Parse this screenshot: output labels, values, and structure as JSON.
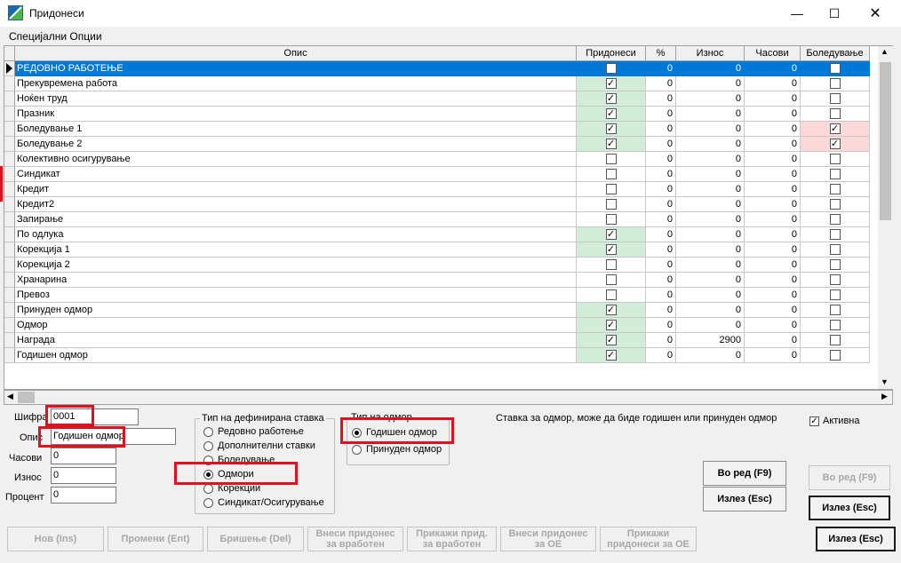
{
  "window": {
    "title": "Придонеси"
  },
  "menu": {
    "special_options": "Специјални Опции"
  },
  "grid": {
    "columns": [
      "Опис",
      "Придонеси",
      "%",
      "Износ",
      "Часови",
      "Боледување"
    ],
    "rows": [
      {
        "desc": "РЕДОВНО РАБОТЕЊЕ",
        "contrib": true,
        "pct": "0",
        "amount": "0",
        "hours": "0",
        "sick": false,
        "selected": true,
        "green": false,
        "pink": false
      },
      {
        "desc": "Прекувремена работа",
        "contrib": true,
        "pct": "0",
        "amount": "0",
        "hours": "0",
        "sick": false,
        "selected": false,
        "green": true,
        "pink": false
      },
      {
        "desc": "Ноќен труд",
        "contrib": true,
        "pct": "0",
        "amount": "0",
        "hours": "0",
        "sick": false,
        "selected": false,
        "green": true,
        "pink": false
      },
      {
        "desc": "Празник",
        "contrib": true,
        "pct": "0",
        "amount": "0",
        "hours": "0",
        "sick": false,
        "selected": false,
        "green": true,
        "pink": false
      },
      {
        "desc": "Боледување 1",
        "contrib": true,
        "pct": "0",
        "amount": "0",
        "hours": "0",
        "sick": true,
        "selected": false,
        "green": true,
        "pink": true
      },
      {
        "desc": "Боледување 2",
        "contrib": true,
        "pct": "0",
        "amount": "0",
        "hours": "0",
        "sick": true,
        "selected": false,
        "green": true,
        "pink": true
      },
      {
        "desc": "Колективно осигурување",
        "contrib": false,
        "pct": "0",
        "amount": "0",
        "hours": "0",
        "sick": false,
        "selected": false,
        "green": false,
        "pink": false
      },
      {
        "desc": "Синдикат",
        "contrib": false,
        "pct": "0",
        "amount": "0",
        "hours": "0",
        "sick": false,
        "selected": false,
        "green": false,
        "pink": false
      },
      {
        "desc": "Кредит",
        "contrib": false,
        "pct": "0",
        "amount": "0",
        "hours": "0",
        "sick": false,
        "selected": false,
        "green": false,
        "pink": false
      },
      {
        "desc": "Кредит2",
        "contrib": false,
        "pct": "0",
        "amount": "0",
        "hours": "0",
        "sick": false,
        "selected": false,
        "green": false,
        "pink": false
      },
      {
        "desc": "Запирање",
        "contrib": false,
        "pct": "0",
        "amount": "0",
        "hours": "0",
        "sick": false,
        "selected": false,
        "green": false,
        "pink": false
      },
      {
        "desc": "По одлука",
        "contrib": true,
        "pct": "0",
        "amount": "0",
        "hours": "0",
        "sick": false,
        "selected": false,
        "green": true,
        "pink": false
      },
      {
        "desc": "Корекција 1",
        "contrib": true,
        "pct": "0",
        "amount": "0",
        "hours": "0",
        "sick": false,
        "selected": false,
        "green": true,
        "pink": false
      },
      {
        "desc": "Корекција 2",
        "contrib": false,
        "pct": "0",
        "amount": "0",
        "hours": "0",
        "sick": false,
        "selected": false,
        "green": false,
        "pink": false
      },
      {
        "desc": "Хранарина",
        "contrib": false,
        "pct": "0",
        "amount": "0",
        "hours": "0",
        "sick": false,
        "selected": false,
        "green": false,
        "pink": false
      },
      {
        "desc": "Превоз",
        "contrib": false,
        "pct": "0",
        "amount": "0",
        "hours": "0",
        "sick": false,
        "selected": false,
        "green": false,
        "pink": false
      },
      {
        "desc": "Принуден одмор",
        "contrib": true,
        "pct": "0",
        "amount": "0",
        "hours": "0",
        "sick": false,
        "selected": false,
        "green": true,
        "pink": false
      },
      {
        "desc": "Одмор",
        "contrib": true,
        "pct": "0",
        "amount": "0",
        "hours": "0",
        "sick": false,
        "selected": false,
        "green": true,
        "pink": false
      },
      {
        "desc": "Награда",
        "contrib": true,
        "pct": "0",
        "amount": "2900",
        "hours": "0",
        "sick": false,
        "selected": false,
        "green": true,
        "pink": false
      },
      {
        "desc": "Годишен одмор",
        "contrib": true,
        "pct": "0",
        "amount": "0",
        "hours": "0",
        "sick": false,
        "selected": false,
        "green": true,
        "pink": false
      }
    ]
  },
  "form": {
    "code_label": "Шифра",
    "code_value": "0001",
    "desc_label": "Опис",
    "desc_value": "Годишен одмор",
    "hours_label": "Часови",
    "hours_value": "0",
    "amount_label": "Износ",
    "amount_value": "0",
    "percent_label": "Процент",
    "percent_value": "0"
  },
  "rate_type": {
    "title": "Тип на дефинирана ставка",
    "options": [
      "Редовно работење",
      "Дополнителни ставки",
      "Боледување",
      "Одмори",
      "Корекции",
      "Синдикат/Осигурување"
    ],
    "selected": 3
  },
  "leave_type": {
    "title": "Тип на одмор",
    "options": [
      "Годишен одмор",
      "Принуден одмор"
    ],
    "selected": 0
  },
  "info_text": "Ставка за одмор, може да биде годишен или принуден одмор",
  "buttons": {
    "in_order": "Во ред (F9)",
    "exit": "Излез (Esc)",
    "in_order_right": "Во ред (F9)",
    "exit_right": "Излез (Esc)",
    "exit_bottom": "Излез (Esc)",
    "new": "Нов (Ins)",
    "edit": "Промени (Ent)",
    "delete": "Бришење (Del)",
    "enter_employee": [
      "Внеси придонес",
      "за вработен"
    ],
    "show_employee": [
      "Прикажи прид.",
      "за вработен"
    ],
    "enter_oe": [
      "Внеси придонес",
      "за ОЕ"
    ],
    "show_oe": [
      "Прикажи",
      "придонеси за ОЕ"
    ]
  },
  "active": {
    "label": "Активна",
    "checked": true
  },
  "colors": {
    "selection": "#0078d7",
    "highlight_red": "#e0101e",
    "green_cell": "#d3ecd8",
    "pink_cell": "#fcd8d8"
  }
}
